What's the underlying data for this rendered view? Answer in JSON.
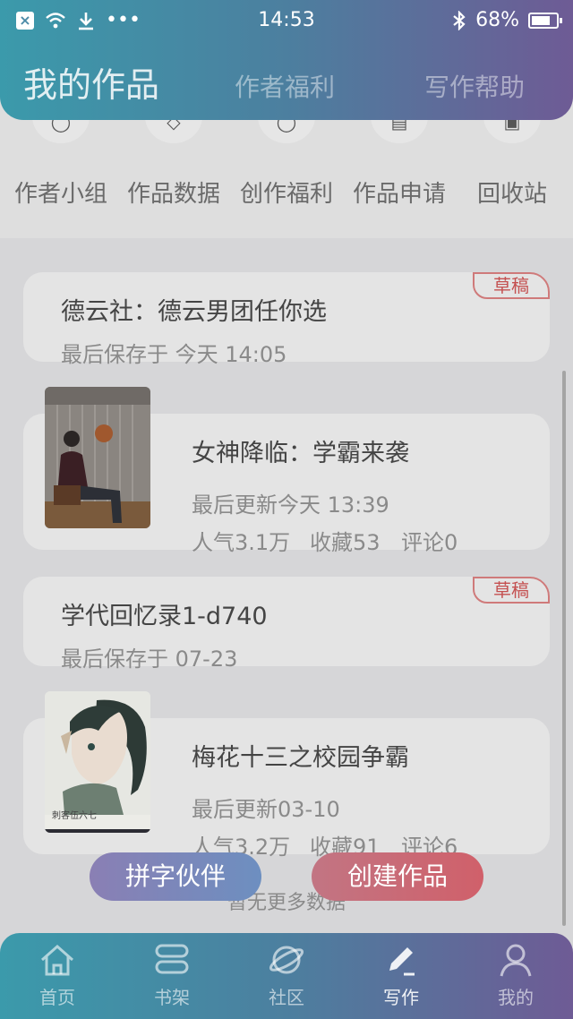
{
  "status_bar": {
    "time": "14:53",
    "battery": "68%"
  },
  "header": {
    "tabs": [
      {
        "label": "我的作品",
        "active": true
      },
      {
        "label": "作者福利",
        "active": false
      },
      {
        "label": "写作帮助",
        "active": false
      }
    ]
  },
  "quick_menu": [
    {
      "label": "作者小组",
      "icon": "group-icon"
    },
    {
      "label": "作品数据",
      "icon": "layers-icon"
    },
    {
      "label": "创作福利",
      "icon": "coin-icon"
    },
    {
      "label": "作品申请",
      "icon": "document-icon"
    },
    {
      "label": "回收站",
      "icon": "trash-icon"
    }
  ],
  "works": [
    {
      "title": "德云社：德云男团任你选",
      "meta": "最后保存于 今天 14:05",
      "tag": "草稿"
    },
    {
      "title": "女神降临：学霸来袭",
      "meta": "最后更新今天 13:39",
      "stats": {
        "popularity": "人气3.1万",
        "favorites": "收藏53",
        "comments": "评论0"
      }
    },
    {
      "title": "学代回忆录1-d740",
      "meta": "最后保存于 07-23",
      "tag": "草稿"
    },
    {
      "title": "梅花十三之校园争霸",
      "meta": "最后更新03-10",
      "stats": {
        "popularity": "人气3.2万",
        "favorites": "收藏91",
        "comments": "评论6"
      },
      "cover_text": "刺客伍六七"
    }
  ],
  "footer_text": "暂无更多数据",
  "fab": {
    "partner": "拼字伙伴",
    "create": "创建作品"
  },
  "bottom_nav": [
    {
      "label": "首页",
      "icon": "home-icon"
    },
    {
      "label": "书架",
      "icon": "bookshelf-icon"
    },
    {
      "label": "社区",
      "icon": "planet-icon"
    },
    {
      "label": "写作",
      "icon": "pen-icon",
      "active": true
    },
    {
      "label": "我的",
      "icon": "person-icon"
    }
  ],
  "colors": {
    "header_start": "#3b9aab",
    "header_end": "#6e5b95",
    "draft_tag": "#c45050",
    "create_button": "#d0606a"
  }
}
